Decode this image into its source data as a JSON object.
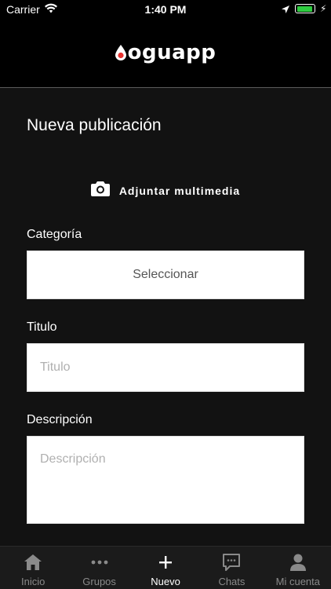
{
  "status_bar": {
    "carrier": "Carrier",
    "time": "1:40 PM",
    "battery_level": 0.95
  },
  "header": {
    "logo_text": "oguapp"
  },
  "page": {
    "title": "Nueva publicación"
  },
  "attach": {
    "label": "Adjuntar multimedia",
    "icon": "camera-icon"
  },
  "form": {
    "category": {
      "label": "Categoría",
      "value": "Seleccionar"
    },
    "title": {
      "label": "Titulo",
      "placeholder": "Titulo"
    },
    "description": {
      "label": "Descripción",
      "placeholder": "Descripción"
    }
  },
  "tabbar": {
    "items": [
      {
        "label": "Inicio",
        "icon": "home-icon"
      },
      {
        "label": "Grupos",
        "icon": "more-dots-icon"
      },
      {
        "label": "Nuevo",
        "icon": "plus-icon",
        "active": true
      },
      {
        "label": "Chats",
        "icon": "chat-icon"
      },
      {
        "label": "Mi cuenta",
        "icon": "person-icon"
      }
    ]
  },
  "colors": {
    "background": "#121212",
    "header": "#000000",
    "accent_drop": "#e8322f",
    "battery": "#2ecc40"
  }
}
